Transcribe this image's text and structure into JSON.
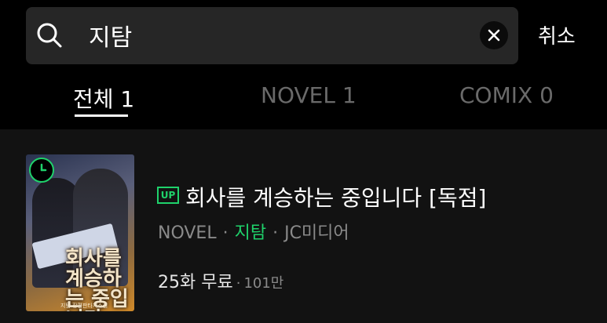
{
  "search": {
    "query": "지탐",
    "cancel_label": "취소"
  },
  "tabs": [
    {
      "label": "전체 1",
      "active": true
    },
    {
      "label": "NOVEL 1",
      "active": false
    },
    {
      "label": "COMIX 0",
      "active": false
    }
  ],
  "results": [
    {
      "badge": "UP",
      "title": "회사를 계승하는 중입니다 [독점]",
      "category": "NOVEL",
      "author": "지탐",
      "publisher": "JC미디어",
      "free_episodes": "25화 무료",
      "views": "101만",
      "cover": {
        "title_text": "회사를 계승하는 중입니다",
        "author_text": "지탐 장편판타지소설"
      }
    }
  ],
  "colors": {
    "background": "#000000",
    "content_background": "#121212",
    "accent": "#1fd26b",
    "search_box": "#262626",
    "inactive_tab": "#6a6a6a"
  }
}
